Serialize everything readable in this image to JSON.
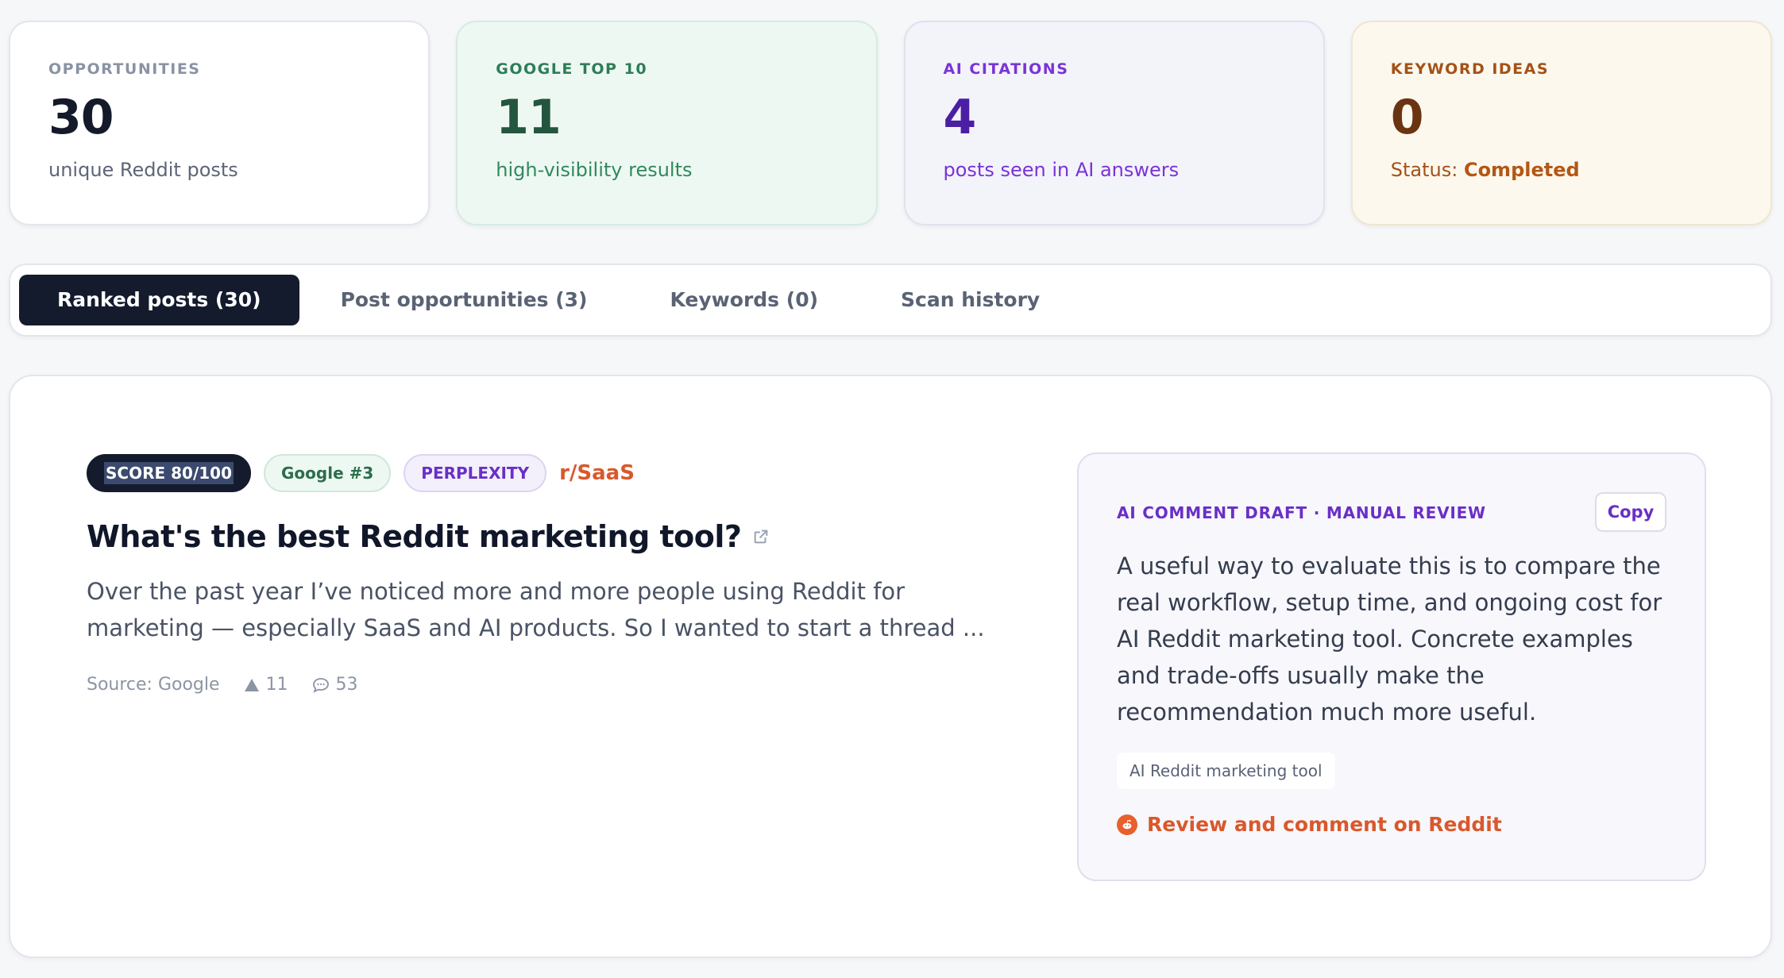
{
  "stats": [
    {
      "label": "OPPORTUNITIES",
      "value": "30",
      "sub": "unique Reddit posts"
    },
    {
      "label": "GOOGLE TOP 10",
      "value": "11",
      "sub": "high-visibility results"
    },
    {
      "label": "AI CITATIONS",
      "value": "4",
      "sub": "posts seen in AI answers"
    },
    {
      "label": "KEYWORD IDEAS",
      "value": "0",
      "sub_prefix": "Status: ",
      "sub_status": "Completed"
    }
  ],
  "tabs": [
    {
      "label": "Ranked posts (30)",
      "active": true
    },
    {
      "label": "Post opportunities (3)"
    },
    {
      "label": "Keywords (0)"
    },
    {
      "label": "Scan history"
    }
  ],
  "post": {
    "score": "SCORE 80/100",
    "google_rank": "Google #3",
    "ai_source": "PERPLEXITY",
    "subreddit": "r/SaaS",
    "title": "What's the best Reddit marketing tool?",
    "body": "Over the past year I’ve noticed more and more people using Reddit for marketing — especially SaaS and AI products. So I wanted to start a thread ...",
    "source": "Source: Google",
    "upvotes": "11",
    "comments": "53"
  },
  "draft": {
    "heading": "AI COMMENT DRAFT · MANUAL REVIEW",
    "copy_label": "Copy",
    "text": "A useful way to evaluate this is to compare the real workflow, setup time, and ongoing cost for AI Reddit marketing tool. Concrete examples and trade-offs usually make the recommendation much more useful.",
    "keyword_tag": "AI Reddit marketing tool",
    "action_label": "Review and comment on Reddit"
  },
  "colors": {
    "dark": "#141b2d",
    "green": "#2e7d58",
    "purple": "#6a2fc7",
    "orange": "#d9582b"
  }
}
